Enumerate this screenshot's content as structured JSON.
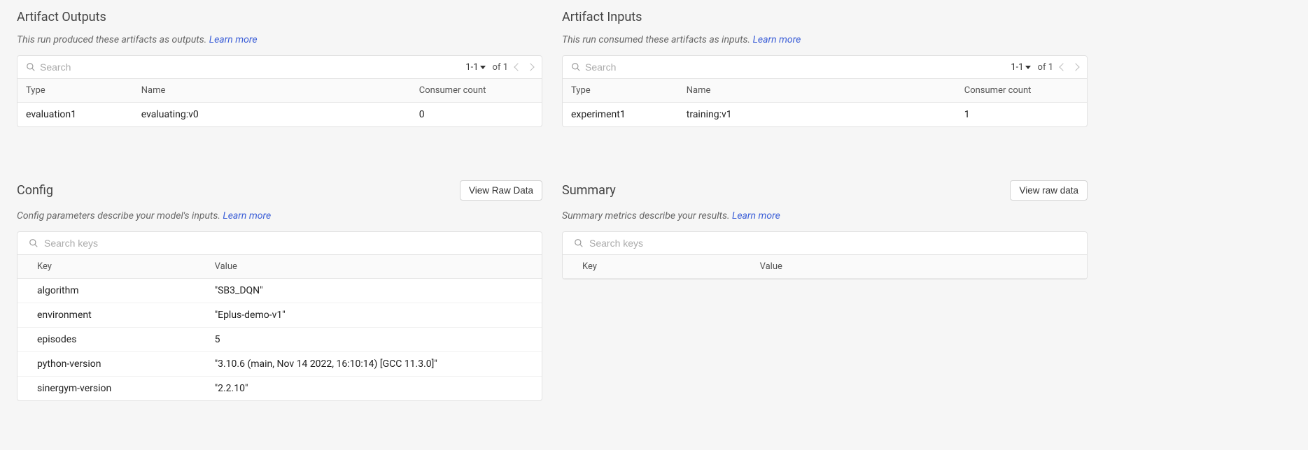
{
  "outputs": {
    "title": "Artifact Outputs",
    "desc_prefix": "This run produced these artifacts as outputs. ",
    "learn_more": "Learn more",
    "search_placeholder": "Search",
    "pager_range": "1-1",
    "pager_of": "of 1",
    "columns": {
      "type": "Type",
      "name": "Name",
      "consumer": "Consumer count"
    },
    "rows": [
      {
        "type": "evaluation1",
        "name": "evaluating:v0",
        "consumer": "0"
      }
    ]
  },
  "inputs": {
    "title": "Artifact Inputs",
    "desc_prefix": "This run consumed these artifacts as inputs. ",
    "learn_more": "Learn more",
    "search_placeholder": "Search",
    "pager_range": "1-1",
    "pager_of": "of 1",
    "columns": {
      "type": "Type",
      "name": "Name",
      "consumer": "Consumer count"
    },
    "rows": [
      {
        "type": "experiment1",
        "name": "training:v1",
        "consumer": "1"
      }
    ]
  },
  "config": {
    "title": "Config",
    "raw_button": "View Raw Data",
    "desc_prefix": "Config parameters describe your model's inputs. ",
    "learn_more": "Learn more",
    "search_placeholder": "Search keys",
    "columns": {
      "key": "Key",
      "value": "Value"
    },
    "rows": [
      {
        "key": "algorithm",
        "value": "\"SB3_DQN\""
      },
      {
        "key": "environment",
        "value": "\"Eplus-demo-v1\""
      },
      {
        "key": "episodes",
        "value": "5"
      },
      {
        "key": "python-version",
        "value": "\"3.10.6 (main, Nov 14 2022, 16:10:14) [GCC 11.3.0]\""
      },
      {
        "key": "sinergym-version",
        "value": "\"2.2.10\""
      }
    ]
  },
  "summary": {
    "title": "Summary",
    "raw_button": "View raw data",
    "desc_prefix": "Summary metrics describe your results. ",
    "learn_more": "Learn more",
    "search_placeholder": "Search keys",
    "columns": {
      "key": "Key",
      "value": "Value"
    },
    "rows": []
  }
}
